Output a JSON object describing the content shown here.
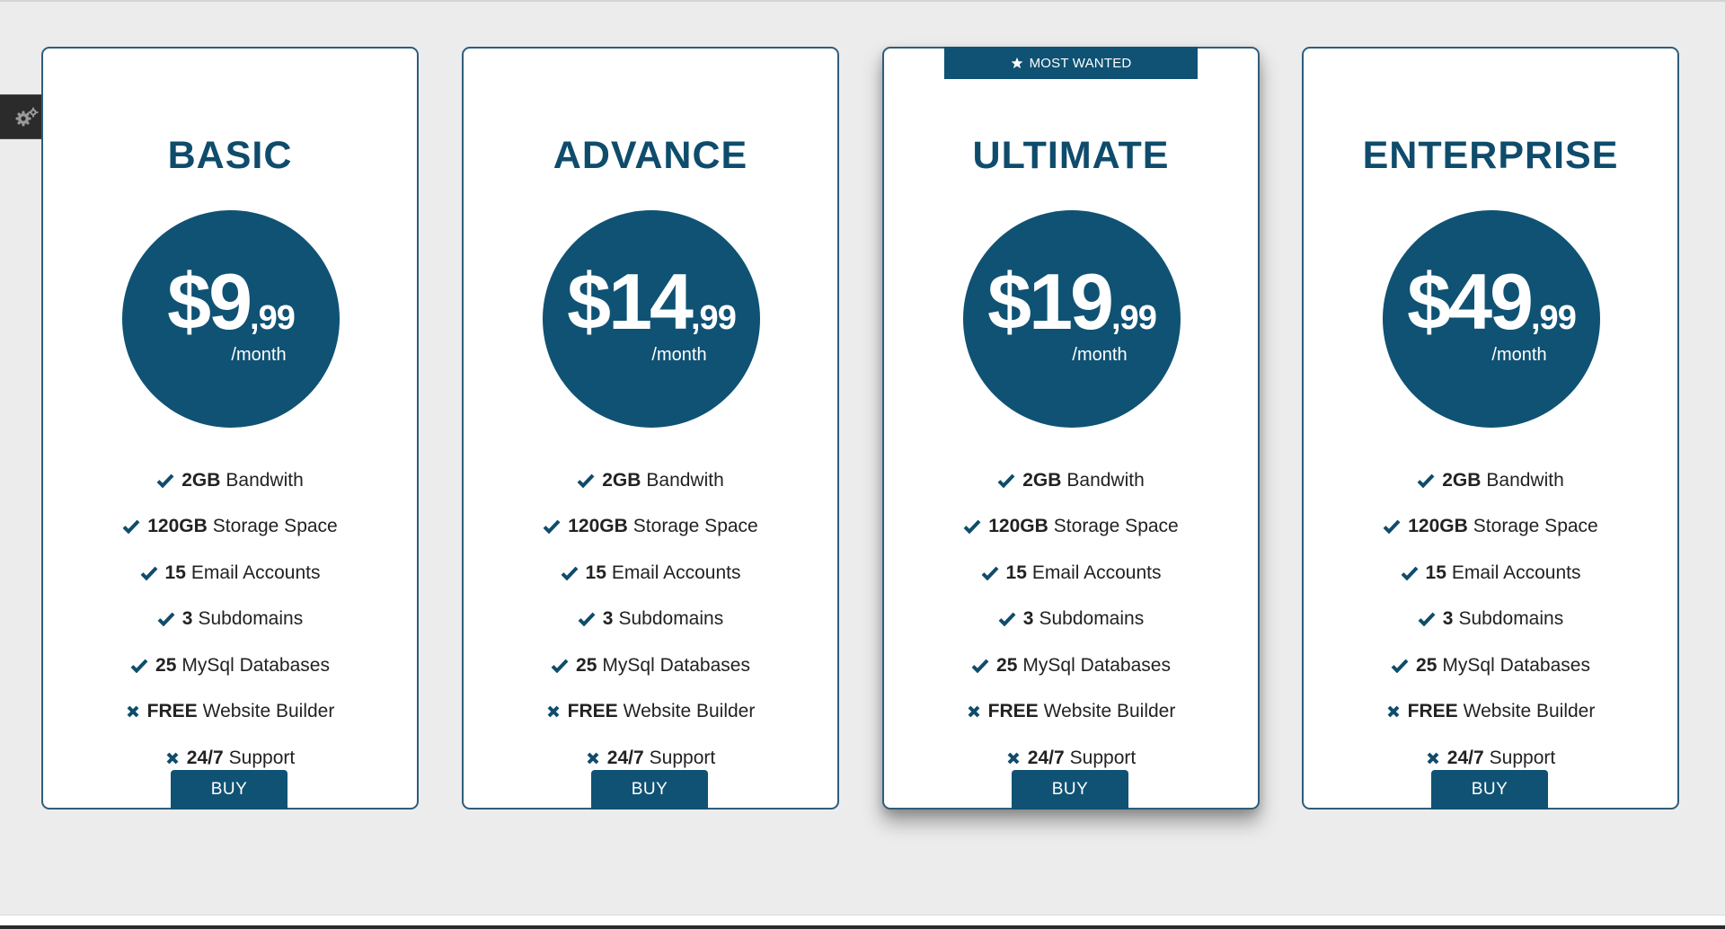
{
  "settings": {
    "icon": "gears-icon"
  },
  "colors": {
    "primary": "#0f5274",
    "heading": "#0f4c6c",
    "background": "#ececec",
    "card": "#ffffff"
  },
  "plans": [
    {
      "name": "BASIC",
      "badge": "",
      "price": {
        "amount": "$9",
        "cents": ",99",
        "period": "/month"
      },
      "features": [
        {
          "icon": "check-icon",
          "bold": "2GB",
          "text": "Bandwith"
        },
        {
          "icon": "check-icon",
          "bold": "120GB",
          "text": "Storage Space"
        },
        {
          "icon": "check-icon",
          "bold": "15",
          "text": "Email Accounts"
        },
        {
          "icon": "check-icon",
          "bold": "3",
          "text": "Subdomains"
        },
        {
          "icon": "check-icon",
          "bold": "25",
          "text": "MySql Databases"
        },
        {
          "icon": "cross-icon",
          "bold": "FREE",
          "text": "Website Builder"
        },
        {
          "icon": "cross-icon",
          "bold": "24/7",
          "text": "Support"
        }
      ],
      "buy_label": "BUY"
    },
    {
      "name": "ADVANCE",
      "badge": "",
      "price": {
        "amount": "$14",
        "cents": ",99",
        "period": "/month"
      },
      "features": [
        {
          "icon": "check-icon",
          "bold": "2GB",
          "text": "Bandwith"
        },
        {
          "icon": "check-icon",
          "bold": "120GB",
          "text": "Storage Space"
        },
        {
          "icon": "check-icon",
          "bold": "15",
          "text": "Email Accounts"
        },
        {
          "icon": "check-icon",
          "bold": "3",
          "text": "Subdomains"
        },
        {
          "icon": "check-icon",
          "bold": "25",
          "text": "MySql Databases"
        },
        {
          "icon": "cross-icon",
          "bold": "FREE",
          "text": "Website Builder"
        },
        {
          "icon": "cross-icon",
          "bold": "24/7",
          "text": "Support"
        }
      ],
      "buy_label": "BUY"
    },
    {
      "name": "ULTIMATE",
      "badge": "MOST WANTED",
      "badge_icon": "star-icon",
      "price": {
        "amount": "$19",
        "cents": ",99",
        "period": "/month"
      },
      "features": [
        {
          "icon": "check-icon",
          "bold": "2GB",
          "text": "Bandwith"
        },
        {
          "icon": "check-icon",
          "bold": "120GB",
          "text": "Storage Space"
        },
        {
          "icon": "check-icon",
          "bold": "15",
          "text": "Email Accounts"
        },
        {
          "icon": "check-icon",
          "bold": "3",
          "text": "Subdomains"
        },
        {
          "icon": "check-icon",
          "bold": "25",
          "text": "MySql Databases"
        },
        {
          "icon": "cross-icon",
          "bold": "FREE",
          "text": "Website Builder"
        },
        {
          "icon": "cross-icon",
          "bold": "24/7",
          "text": "Support"
        }
      ],
      "buy_label": "BUY"
    },
    {
      "name": "ENTERPRISE",
      "badge": "",
      "price": {
        "amount": "$49",
        "cents": ",99",
        "period": "/month"
      },
      "features": [
        {
          "icon": "check-icon",
          "bold": "2GB",
          "text": "Bandwith"
        },
        {
          "icon": "check-icon",
          "bold": "120GB",
          "text": "Storage Space"
        },
        {
          "icon": "check-icon",
          "bold": "15",
          "text": "Email Accounts"
        },
        {
          "icon": "check-icon",
          "bold": "3",
          "text": "Subdomains"
        },
        {
          "icon": "check-icon",
          "bold": "25",
          "text": "MySql Databases"
        },
        {
          "icon": "cross-icon",
          "bold": "FREE",
          "text": "Website Builder"
        },
        {
          "icon": "cross-icon",
          "bold": "24/7",
          "text": "Support"
        }
      ],
      "buy_label": "BUY"
    }
  ]
}
